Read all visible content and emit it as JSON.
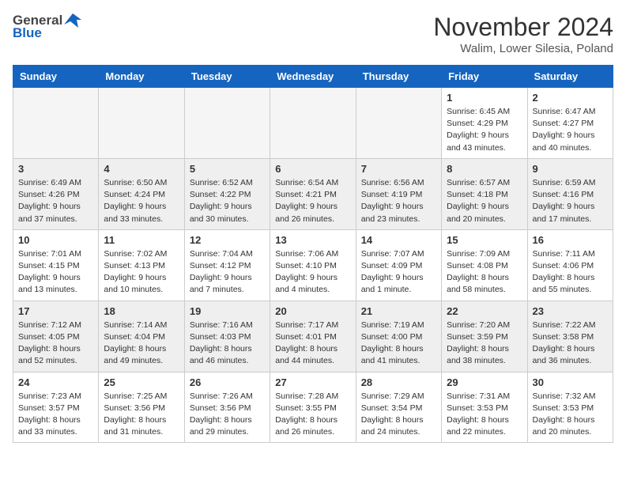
{
  "logo": {
    "general": "General",
    "blue": "Blue"
  },
  "title": "November 2024",
  "location": "Walim, Lower Silesia, Poland",
  "days_of_week": [
    "Sunday",
    "Monday",
    "Tuesday",
    "Wednesday",
    "Thursday",
    "Friday",
    "Saturday"
  ],
  "weeks": [
    {
      "shaded": false,
      "days": [
        {
          "num": "",
          "info": ""
        },
        {
          "num": "",
          "info": ""
        },
        {
          "num": "",
          "info": ""
        },
        {
          "num": "",
          "info": ""
        },
        {
          "num": "",
          "info": ""
        },
        {
          "num": "1",
          "info": "Sunrise: 6:45 AM\nSunset: 4:29 PM\nDaylight: 9 hours\nand 43 minutes."
        },
        {
          "num": "2",
          "info": "Sunrise: 6:47 AM\nSunset: 4:27 PM\nDaylight: 9 hours\nand 40 minutes."
        }
      ]
    },
    {
      "shaded": true,
      "days": [
        {
          "num": "3",
          "info": "Sunrise: 6:49 AM\nSunset: 4:26 PM\nDaylight: 9 hours\nand 37 minutes."
        },
        {
          "num": "4",
          "info": "Sunrise: 6:50 AM\nSunset: 4:24 PM\nDaylight: 9 hours\nand 33 minutes."
        },
        {
          "num": "5",
          "info": "Sunrise: 6:52 AM\nSunset: 4:22 PM\nDaylight: 9 hours\nand 30 minutes."
        },
        {
          "num": "6",
          "info": "Sunrise: 6:54 AM\nSunset: 4:21 PM\nDaylight: 9 hours\nand 26 minutes."
        },
        {
          "num": "7",
          "info": "Sunrise: 6:56 AM\nSunset: 4:19 PM\nDaylight: 9 hours\nand 23 minutes."
        },
        {
          "num": "8",
          "info": "Sunrise: 6:57 AM\nSunset: 4:18 PM\nDaylight: 9 hours\nand 20 minutes."
        },
        {
          "num": "9",
          "info": "Sunrise: 6:59 AM\nSunset: 4:16 PM\nDaylight: 9 hours\nand 17 minutes."
        }
      ]
    },
    {
      "shaded": false,
      "days": [
        {
          "num": "10",
          "info": "Sunrise: 7:01 AM\nSunset: 4:15 PM\nDaylight: 9 hours\nand 13 minutes."
        },
        {
          "num": "11",
          "info": "Sunrise: 7:02 AM\nSunset: 4:13 PM\nDaylight: 9 hours\nand 10 minutes."
        },
        {
          "num": "12",
          "info": "Sunrise: 7:04 AM\nSunset: 4:12 PM\nDaylight: 9 hours\nand 7 minutes."
        },
        {
          "num": "13",
          "info": "Sunrise: 7:06 AM\nSunset: 4:10 PM\nDaylight: 9 hours\nand 4 minutes."
        },
        {
          "num": "14",
          "info": "Sunrise: 7:07 AM\nSunset: 4:09 PM\nDaylight: 9 hours\nand 1 minute."
        },
        {
          "num": "15",
          "info": "Sunrise: 7:09 AM\nSunset: 4:08 PM\nDaylight: 8 hours\nand 58 minutes."
        },
        {
          "num": "16",
          "info": "Sunrise: 7:11 AM\nSunset: 4:06 PM\nDaylight: 8 hours\nand 55 minutes."
        }
      ]
    },
    {
      "shaded": true,
      "days": [
        {
          "num": "17",
          "info": "Sunrise: 7:12 AM\nSunset: 4:05 PM\nDaylight: 8 hours\nand 52 minutes."
        },
        {
          "num": "18",
          "info": "Sunrise: 7:14 AM\nSunset: 4:04 PM\nDaylight: 8 hours\nand 49 minutes."
        },
        {
          "num": "19",
          "info": "Sunrise: 7:16 AM\nSunset: 4:03 PM\nDaylight: 8 hours\nand 46 minutes."
        },
        {
          "num": "20",
          "info": "Sunrise: 7:17 AM\nSunset: 4:01 PM\nDaylight: 8 hours\nand 44 minutes."
        },
        {
          "num": "21",
          "info": "Sunrise: 7:19 AM\nSunset: 4:00 PM\nDaylight: 8 hours\nand 41 minutes."
        },
        {
          "num": "22",
          "info": "Sunrise: 7:20 AM\nSunset: 3:59 PM\nDaylight: 8 hours\nand 38 minutes."
        },
        {
          "num": "23",
          "info": "Sunrise: 7:22 AM\nSunset: 3:58 PM\nDaylight: 8 hours\nand 36 minutes."
        }
      ]
    },
    {
      "shaded": false,
      "days": [
        {
          "num": "24",
          "info": "Sunrise: 7:23 AM\nSunset: 3:57 PM\nDaylight: 8 hours\nand 33 minutes."
        },
        {
          "num": "25",
          "info": "Sunrise: 7:25 AM\nSunset: 3:56 PM\nDaylight: 8 hours\nand 31 minutes."
        },
        {
          "num": "26",
          "info": "Sunrise: 7:26 AM\nSunset: 3:56 PM\nDaylight: 8 hours\nand 29 minutes."
        },
        {
          "num": "27",
          "info": "Sunrise: 7:28 AM\nSunset: 3:55 PM\nDaylight: 8 hours\nand 26 minutes."
        },
        {
          "num": "28",
          "info": "Sunrise: 7:29 AM\nSunset: 3:54 PM\nDaylight: 8 hours\nand 24 minutes."
        },
        {
          "num": "29",
          "info": "Sunrise: 7:31 AM\nSunset: 3:53 PM\nDaylight: 8 hours\nand 22 minutes."
        },
        {
          "num": "30",
          "info": "Sunrise: 7:32 AM\nSunset: 3:53 PM\nDaylight: 8 hours\nand 20 minutes."
        }
      ]
    }
  ]
}
